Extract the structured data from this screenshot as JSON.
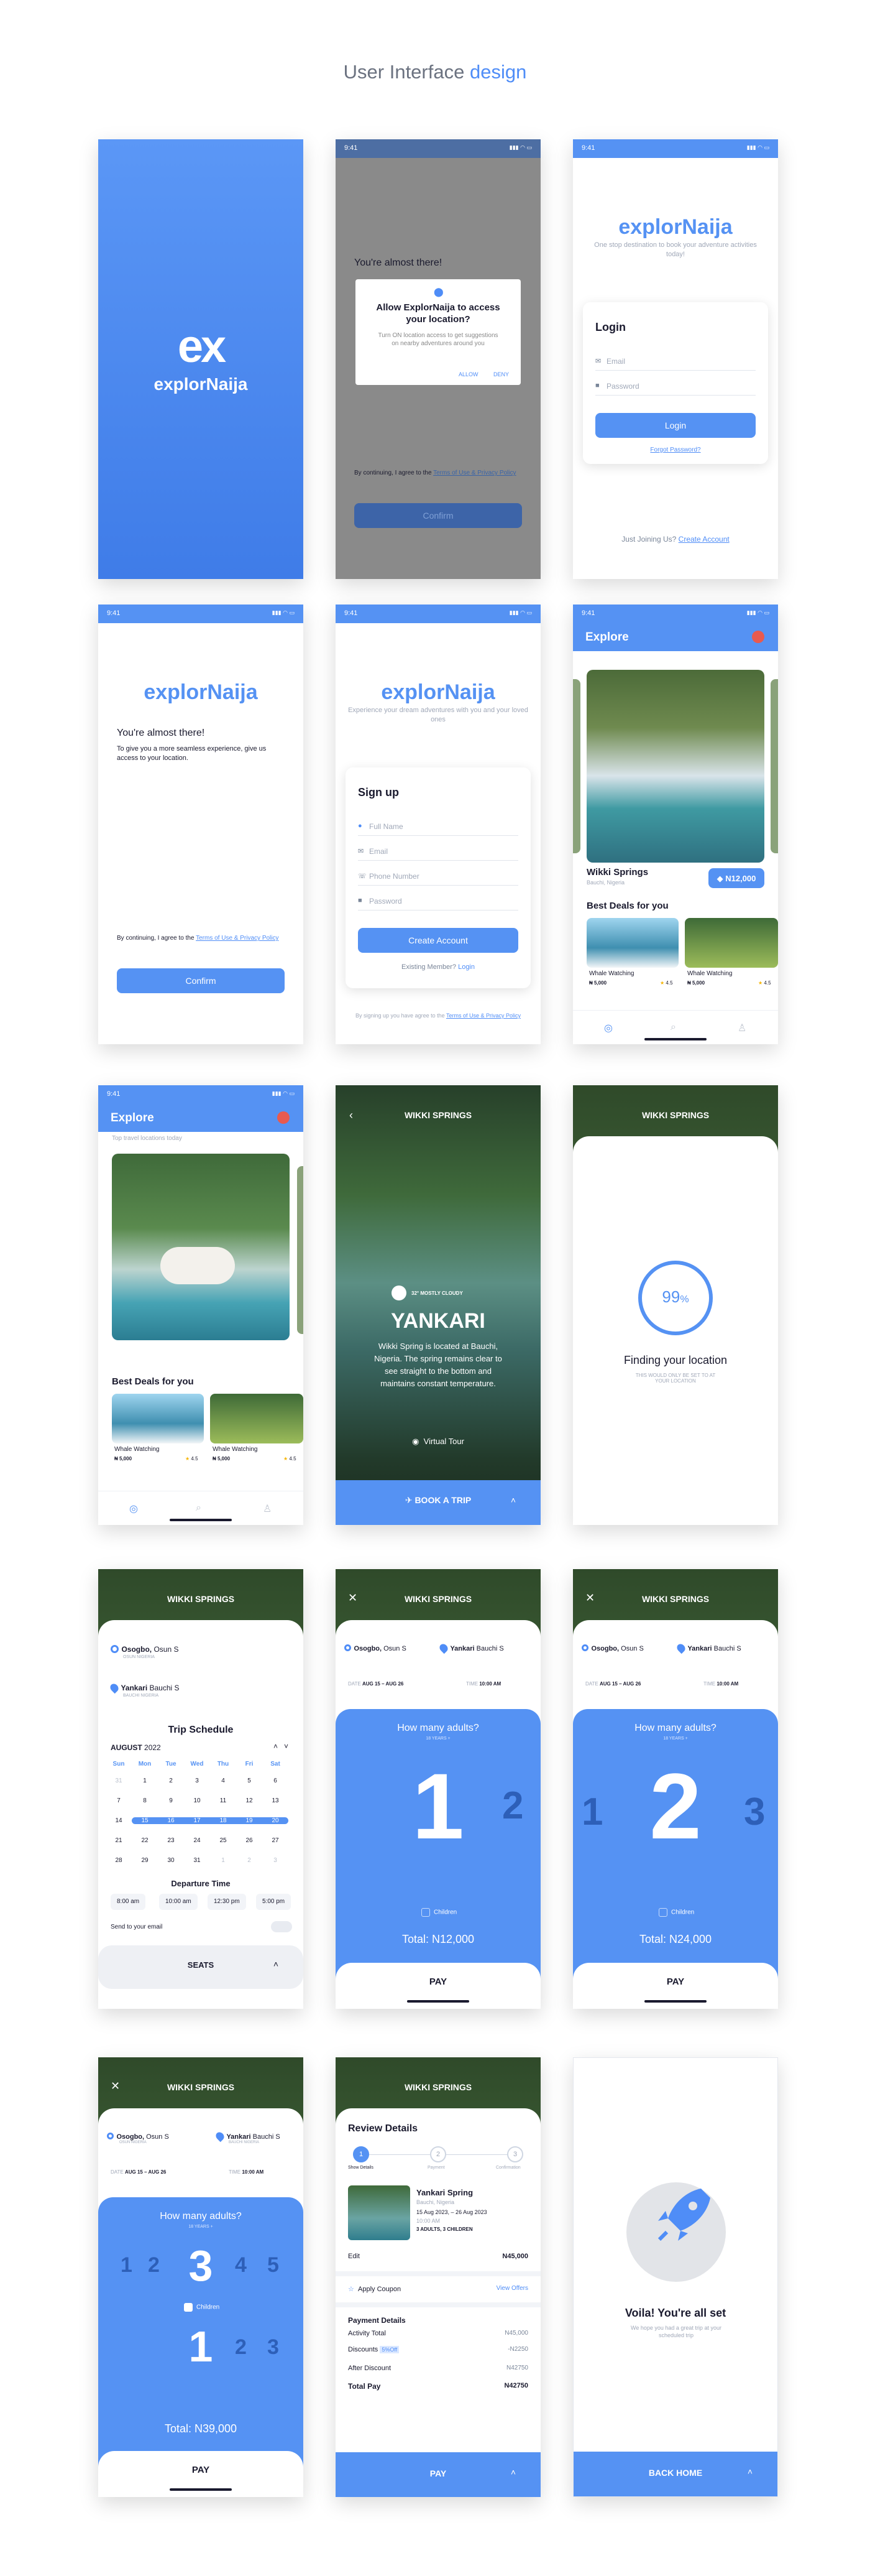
{
  "header": {
    "title_plain": "User Interface",
    "title_accent": "design"
  },
  "common": {
    "time": "9:41",
    "signal": "▮▮▮ ◠ ▭"
  },
  "s1": {
    "mark": "ex",
    "brand": "explorNaija"
  },
  "s2": {
    "bg_title": "You're almost there!",
    "dialog_title": "Allow ExplorNaija to access your location?",
    "dialog_text": "Turn ON location access to get suggestions on nearby adventures around you",
    "allow": "ALLOW",
    "deny": "DENY",
    "footer_pre": "By continuing, I agree to the ",
    "footer_link": "Terms of Use & Privacy Policy",
    "confirm": "Confirm"
  },
  "s3": {
    "brand": "explorNaija",
    "tagline": "One stop destination to book your adventure activities today!",
    "login_title": "Login",
    "email_ph": "Email",
    "password_ph": "Password",
    "login_btn": "Login",
    "forgot": "Forgot Password?",
    "joining_pre": "Just Joining Us? ",
    "create": "Create Account"
  },
  "s4": {
    "brand": "explorNaija",
    "title": "You're almost there!",
    "text": "To give you a more seamless experience, give us access to your location.",
    "footer_pre": "By continuing, I agree to the ",
    "footer_link": "Terms of Use & Privacy Policy",
    "confirm": "Confirm"
  },
  "s5": {
    "brand": "explorNaija",
    "tagline": "Experience your dream adventures with you and your loved ones",
    "signup": "Sign up",
    "full_name": "Full Name",
    "email": "Email",
    "phone": "Phone Number",
    "password": "Password",
    "create_btn": "Create Account",
    "existing_pre": "Existing Member? ",
    "login": "Login",
    "bottom_pre": "By signing up you have agree to the ",
    "bottom_link": "Terms of Use & Privacy Policy"
  },
  "s6": {
    "title": "Explore",
    "place": "Wikki Springs",
    "place_sub": "Bauchi, Nigeria",
    "price": "N12,000",
    "best": "Best Deals for you",
    "deal1": "Whale Watching",
    "deal2": "Whale Watching",
    "deal_price": "₦ 5,000",
    "rating": "4.5"
  },
  "s7": {
    "title": "Explore",
    "tagline": "Top travel locations today",
    "best": "Best Deals for you",
    "deal1": "Whale Watching",
    "deal2": "Whale Watching",
    "deal_price": "₦ 5,000",
    "rating": "4.5"
  },
  "s8": {
    "title": "WIKKI SPRINGS",
    "weather": "32° MOSTLY CLOUDY",
    "name": "YANKARI",
    "desc": "Wikki Spring is located at Bauchi, Nigeria. The spring remains clear to see straight to the bottom and maintains constant temperature.",
    "tour": "Virtual Tour",
    "book": "BOOK A TRIP"
  },
  "s9": {
    "title": "WIKKI SPRINGS",
    "percent": "99",
    "percent_sign": "%",
    "finding": "Finding your location",
    "note": "THIS WOULD ONLY BE SET TO AT YOUR LOCATION"
  },
  "s10": {
    "title": "WIKKI SPRINGS",
    "from": "Osogbo,",
    "from_state": " Osun S",
    "from_sub": "OSUN NIGERIA",
    "to": "Yankari",
    "to_state": " Bauchi S",
    "to_sub": "BAUCHI NIGERIA",
    "schedule": "Trip Schedule",
    "month": "AUGUST",
    "year": "2022",
    "days": [
      "Sun",
      "Mon",
      "Tue",
      "Wed",
      "Thu",
      "Fri",
      "Sat"
    ],
    "weeks": [
      [
        "31",
        "1",
        "2",
        "3",
        "4",
        "5",
        "6"
      ],
      [
        "7",
        "8",
        "9",
        "10",
        "11",
        "12",
        "13"
      ],
      [
        "14",
        "15",
        "16",
        "17",
        "18",
        "19",
        "20"
      ],
      [
        "21",
        "22",
        "23",
        "24",
        "25",
        "26",
        "27"
      ],
      [
        "28",
        "29",
        "30",
        "31",
        "1",
        "2",
        "3"
      ]
    ],
    "departure": "Departure Time",
    "times": [
      "8:00 am",
      "10:00 am",
      "12:30 pm",
      "5:00 pm"
    ],
    "send": "Send to your email",
    "seats": "SEATS"
  },
  "s11": {
    "title": "WIKKI SPRINGS",
    "from": "Osogbo,",
    "from_state": " Osun S",
    "to": "Yankari",
    "to_state": " Bauchi S",
    "date_label": "DATE",
    "date": "AUG 15 – AUG 26",
    "time_label": "TIME",
    "time": "10:00 AM",
    "question": "How many adults?",
    "age": "18 YEARS +",
    "big": "1",
    "next": "2",
    "children": "Children",
    "total_label": "Total: ",
    "total": "N12,000",
    "pay": "PAY"
  },
  "s12": {
    "title": "WIKKI SPRINGS",
    "from": "Osogbo,",
    "from_state": " Osun S",
    "to": "Yankari",
    "to_state": " Bauchi S",
    "date_label": "DATE",
    "date": "AUG 15 – AUG 26",
    "time_label": "TIME",
    "time": "10:00 AM",
    "question": "How many adults?",
    "age": "18 YEARS +",
    "prev": "1",
    "big": "2",
    "next": "3",
    "children": "Children",
    "total_label": "Total: ",
    "total": "N24,000",
    "pay": "PAY"
  },
  "s13": {
    "title": "WIKKI SPRINGS",
    "from": "Osogbo,",
    "from_state": " Osun S",
    "from_sub": "OSUN NIGERIA",
    "to": "Yankari",
    "to_state": " Bauchi S",
    "to_sub": "BAUCHI NIGERIA",
    "date_label": "DATE",
    "date": "AUG 15 – AUG 26",
    "time_label": "TIME",
    "time": "10:00 AM",
    "question": "How many adults?",
    "age": "18 YEARS +",
    "n1": "1",
    "n2": "2",
    "big": "3",
    "n4": "4",
    "n5": "5",
    "children": "Children",
    "c_big": "1",
    "c2": "2",
    "c3": "3",
    "total_label": "Total: ",
    "total": "N39,000",
    "pay": "PAY"
  },
  "s14": {
    "title": "WIKKI SPRINGS",
    "review": "Review Details",
    "step1": "1",
    "step2": "2",
    "step3": "3",
    "l1": "Show Details",
    "l2": "Payment",
    "l3": "Confirmation",
    "spot": "Yankari Spring",
    "spot_loc": "Bauchi, Nigeria",
    "spot_date": "15 Aug 2023, – 26 Aug 2023",
    "spot_time": "10:00 AM",
    "spot_guests": "3 ADULTS, 3 CHILDREN",
    "edit": "Edit",
    "edit_amt": "N45,000",
    "coupon": "Apply Coupon",
    "offers": "View Offers",
    "pd": "Payment Details",
    "act": "Activity Total",
    "act_amt": "N45,000",
    "disc": "Discounts",
    "disc_tag": "5%Off",
    "disc_amt": "-N2250",
    "after": "After Discount",
    "after_amt": "N42750",
    "total": "Total Pay",
    "total_amt": "N42750",
    "pay": "PAY"
  },
  "s15": {
    "voila": "Voila! You're all set",
    "note": "We hope you had a great trip at your scheduled trip",
    "back": "BACK HOME"
  }
}
